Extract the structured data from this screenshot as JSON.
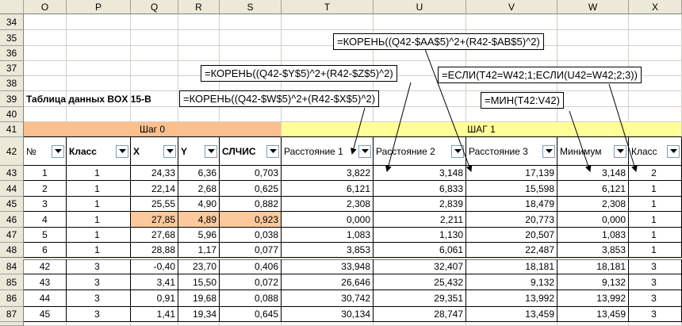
{
  "columns": [
    "O",
    "P",
    "Q",
    "R",
    "S",
    "T",
    "U",
    "V",
    "W",
    "X"
  ],
  "rows_top": [
    "34",
    "35",
    "36",
    "37",
    "38",
    "39",
    "40",
    "41",
    "42",
    "43",
    "44",
    "45",
    "46",
    "47",
    "48"
  ],
  "rows_bottom": [
    "84",
    "85",
    "86",
    "87"
  ],
  "table_title": "Таблица данных BOX 15-В",
  "step0_label": "Шаг 0",
  "step1_label": "ШАГ 1",
  "headers": [
    "№",
    "Класс",
    "X",
    "Y",
    "СЛЧИС",
    "Расстояние 1",
    "Расстояние 2",
    "Расстояние 3",
    "Минимум",
    "Класс"
  ],
  "data_top": [
    [
      "1",
      "1",
      "24,33",
      "6,36",
      "0,703",
      "3,822",
      "3,148",
      "17,139",
      "3,148",
      "2"
    ],
    [
      "2",
      "1",
      "22,14",
      "2,68",
      "0,625",
      "6,121",
      "6,833",
      "15,598",
      "6,121",
      "1"
    ],
    [
      "3",
      "1",
      "25,55",
      "4,90",
      "0,882",
      "2,308",
      "2,839",
      "18,479",
      "2,308",
      "1"
    ],
    [
      "4",
      "1",
      "27,85",
      "4,89",
      "0,923",
      "0,000",
      "2,211",
      "20,773",
      "0,000",
      "1"
    ],
    [
      "5",
      "1",
      "27,68",
      "5,96",
      "0,038",
      "1,083",
      "1,130",
      "20,507",
      "1,083",
      "1"
    ],
    [
      "6",
      "1",
      "28,88",
      "1,17",
      "0,077",
      "3,853",
      "6,061",
      "22,487",
      "3,853",
      "1"
    ]
  ],
  "data_bottom": [
    [
      "42",
      "3",
      "-0,40",
      "23,70",
      "0,406",
      "33,948",
      "32,407",
      "18,181",
      "18,181",
      "3"
    ],
    [
      "43",
      "3",
      "3,41",
      "15,50",
      "0,072",
      "26,646",
      "25,432",
      "9,132",
      "9,132",
      "3"
    ],
    [
      "44",
      "3",
      "0,91",
      "19,68",
      "0,088",
      "30,742",
      "29,351",
      "13,992",
      "13,992",
      "3"
    ],
    [
      "45",
      "3",
      "1,41",
      "19,34",
      "0,645",
      "30,134",
      "28,747",
      "13,459",
      "13,459",
      "3"
    ]
  ],
  "formulas": {
    "dist1": "=КОРЕНЬ((Q42-$W$5)^2+(R42-$X$5)^2)",
    "dist2": "=КОРЕНЬ((Q42-$Y$5)^2+(R42-$Z$5)^2)",
    "dist3": "=КОРЕНЬ((Q42-$AA$5)^2+(R42-$AB$5)^2)",
    "class": "=ЕСЛИ(T42=W42;1;ЕСЛИ(U42=W42;2;3))",
    "min": "=МИН(T42:V42)"
  },
  "colors": {
    "step0_fill": "#fbbf8e",
    "step1_fill": "#ffff99",
    "highlight_fill": "#fbc99c",
    "header_bg": "#ece9d8",
    "arrow": "#000000"
  },
  "icons": {
    "dropdown": "chevron-down-icon"
  }
}
